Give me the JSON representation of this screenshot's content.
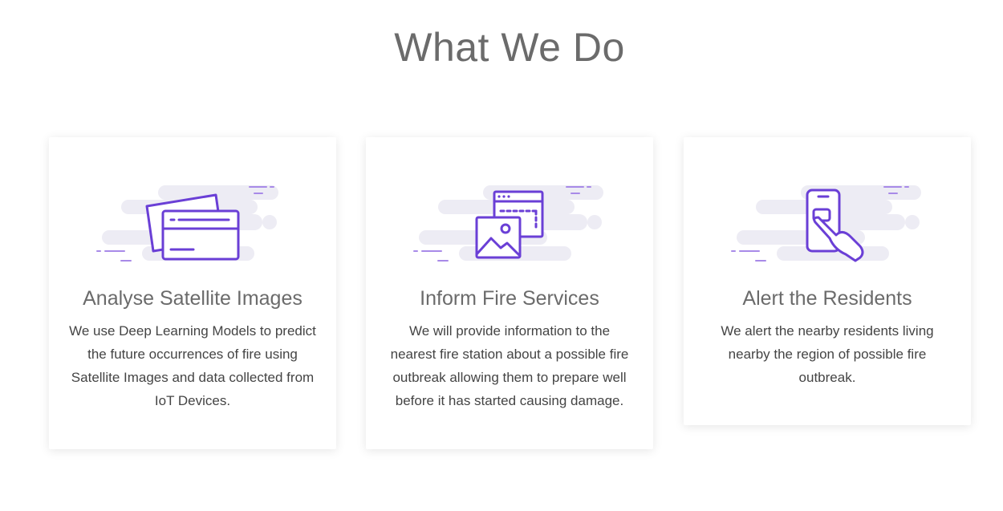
{
  "section": {
    "title": "What We Do"
  },
  "colors": {
    "accent": "#6a3fd6",
    "accent_light": "#a88ae8",
    "blob": "#edecf4",
    "title": "#6b6b6b",
    "text": "#444444"
  },
  "cards": [
    {
      "icon": "credit-card-icon",
      "title": "Analyse Satellite Images",
      "text": "We use Deep Learning Models to predict the future occurrences of fire using Satellite Images and data collected from IoT Devices."
    },
    {
      "icon": "image-window-icon",
      "title": "Inform Fire Services",
      "text": "We will provide information to the nearest fire station about a possible fire outbreak allowing them to prepare well before it has started causing damage."
    },
    {
      "icon": "phone-tap-icon",
      "title": "Alert the Residents",
      "text": "We alert the nearby residents living nearby the region of possible fire outbreak."
    }
  ]
}
